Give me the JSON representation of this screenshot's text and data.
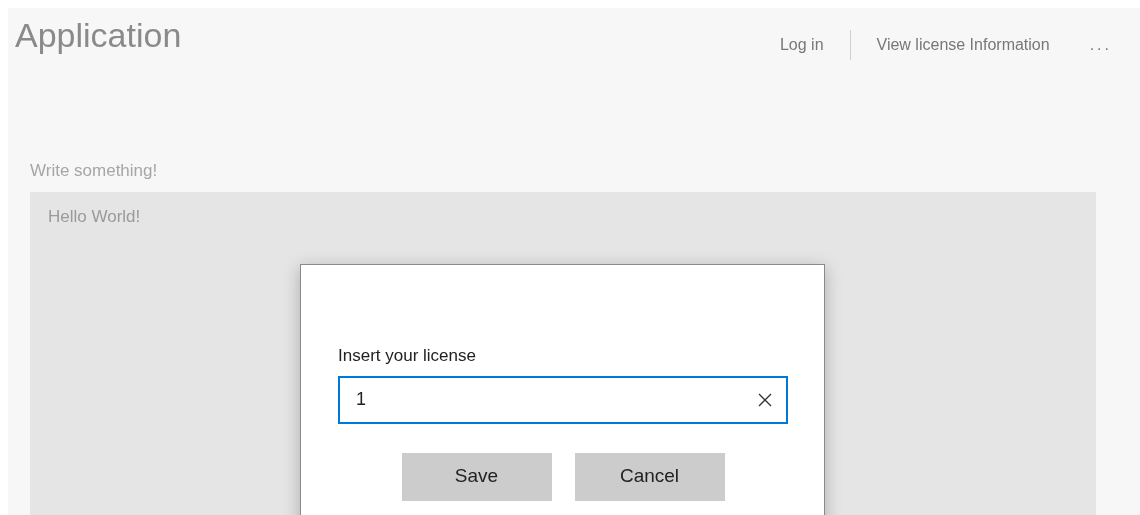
{
  "app": {
    "title": "Application"
  },
  "commands": [
    {
      "label": "Log in"
    },
    {
      "label": "View license Information"
    }
  ],
  "more": {
    "label": "..."
  },
  "editor": {
    "header": "Write something!",
    "placeholder": "Hello World!"
  },
  "dialog": {
    "label": "Insert your license",
    "value": "1",
    "buttons": [
      {
        "label": "Save"
      },
      {
        "label": "Cancel"
      }
    ]
  }
}
